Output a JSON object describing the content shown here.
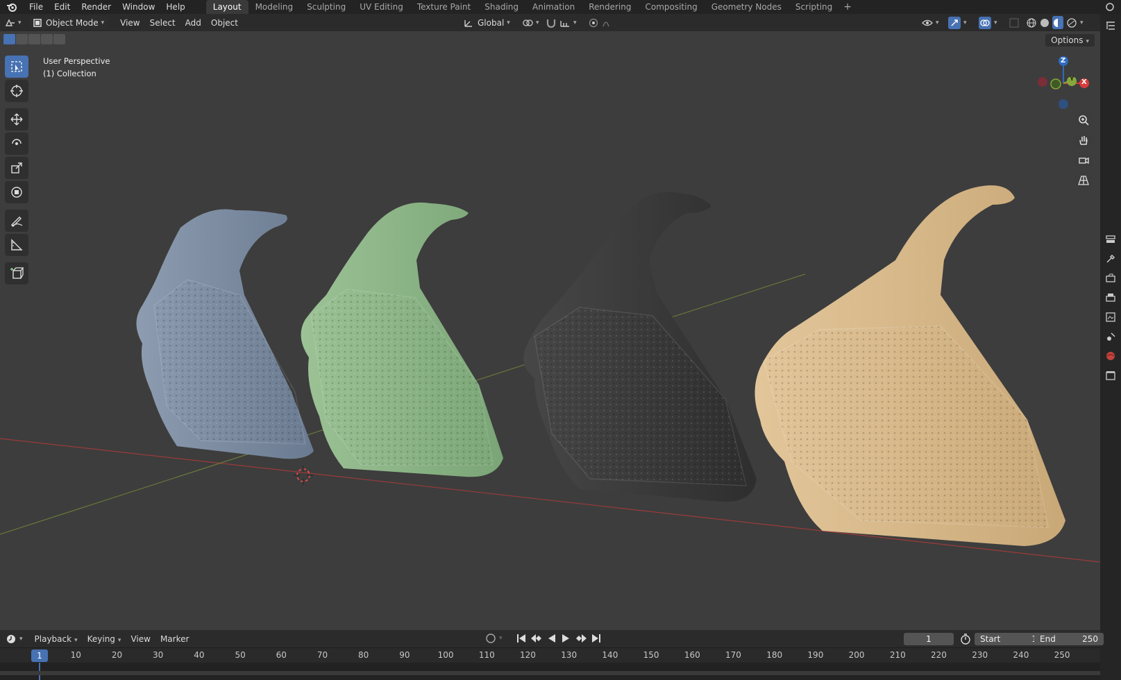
{
  "topbar": {
    "menus": [
      "File",
      "Edit",
      "Render",
      "Window",
      "Help"
    ],
    "workspaces": [
      "Layout",
      "Modeling",
      "Sculpting",
      "UV Editing",
      "Texture Paint",
      "Shading",
      "Animation",
      "Rendering",
      "Compositing",
      "Geometry Nodes",
      "Scripting"
    ],
    "active_workspace": "Layout",
    "add_symbol": "+"
  },
  "header": {
    "mode": "Object Mode",
    "menus": [
      "View",
      "Select",
      "Add",
      "Object"
    ],
    "orientation": "Global"
  },
  "viewport": {
    "perspective": "User Perspective",
    "collection": "(1) Collection",
    "options_label": "Options",
    "gizmo": {
      "z": "Z",
      "y": "Y",
      "x": "X"
    },
    "background_color": "#3d3d3d",
    "grip_colors": {
      "blue": "#7f8fa3",
      "green": "#8fb38a",
      "black": "#3c3c3c",
      "tan": "#d7b98c"
    }
  },
  "timeline": {
    "menus": [
      "Playback",
      "Keying",
      "View",
      "Marker"
    ],
    "current_frame": "1",
    "start_label": "Start",
    "start_value": "1",
    "end_label": "End",
    "end_value": "250",
    "ruler_labels": [
      "1",
      "10",
      "20",
      "30",
      "40",
      "50",
      "60",
      "70",
      "80",
      "90",
      "100",
      "110",
      "120",
      "130",
      "140",
      "150",
      "160",
      "170",
      "180",
      "190",
      "200",
      "210",
      "220",
      "230",
      "240",
      "250"
    ]
  }
}
